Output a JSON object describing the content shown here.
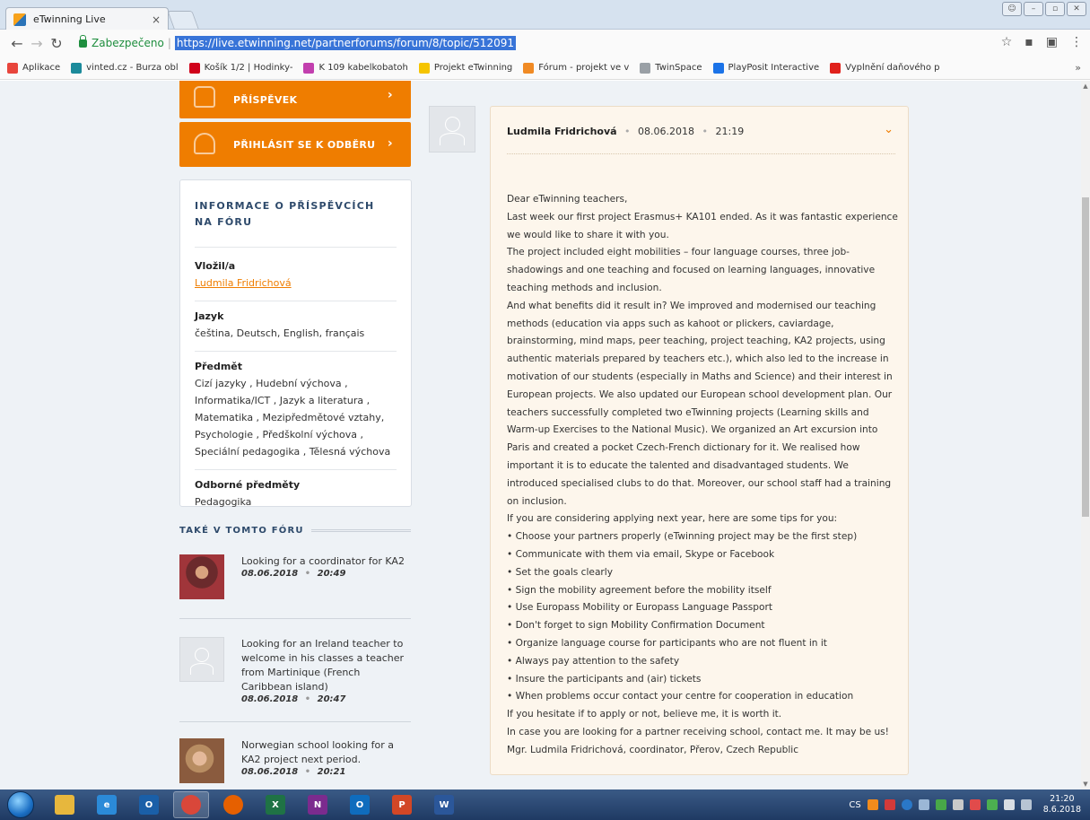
{
  "browser": {
    "tab_title": "eTwinning Live",
    "tab_close": "×",
    "secure_label": "Zabezpečeno",
    "url": "https://live.etwinning.net/partnerforums/forum/8/topic/512091",
    "bookmarks": [
      {
        "label": "Aplikace",
        "color": "#e8453c"
      },
      {
        "label": "vinted.cz - Burza obl",
        "color": "#1b8a9b"
      },
      {
        "label": "Košík 1/2 | Hodinky-",
        "color": "#d0021b"
      },
      {
        "label": "K 109 kabelkobatoh",
        "color": "#c23fae"
      },
      {
        "label": "Projekt eTwinning",
        "color": "#f5c400"
      },
      {
        "label": "Fórum - projekt ve v",
        "color": "#f08a24"
      },
      {
        "label": "TwinSpace",
        "color": "#9aa0a6"
      },
      {
        "label": "PlayPosit Interactive",
        "color": "#1b73e8"
      },
      {
        "label": "Vyplnění daňového p",
        "color": "#e0211b"
      }
    ],
    "bookmarks_more": "»"
  },
  "sidebar": {
    "buttons": [
      {
        "label": "PŘÍSPĚVEK"
      },
      {
        "label": "PŘIHLÁSIT SE K ODBĚRU"
      }
    ],
    "info": {
      "title": "INFORMACE O PŘÍSPĚVCÍCH NA FÓRU",
      "author_label": "Vložil/a",
      "author": "Ludmila Fridrichová",
      "language_label": "Jazyk",
      "language": "čeština, Deutsch, English, français",
      "subject_label": "Předmět",
      "subject": "Cizí jazyky , Hudební výchova , Informatika/ICT , Jazyk a literatura , Matematika , Mezipředmětové vztahy, Psychologie , Předškolní výchova , Speciální pedagogika , Tělesná výchova",
      "specialized_label": "Odborné předměty",
      "specialized": "Pedagogika"
    },
    "also_title": "TAKÉ V TOMTO FÓRU",
    "also_items": [
      {
        "title": "Looking for a coordinator for KA2",
        "date": "08.06.2018",
        "time": "20:49"
      },
      {
        "title": "Looking for an Ireland teacher to welcome in his classes a teacher from Martinique (French Caribbean island)",
        "date": "08.06.2018",
        "time": "20:47"
      },
      {
        "title": "Norwegian school looking for a KA2 project next period.",
        "date": "08.06.2018",
        "time": "20:21"
      }
    ]
  },
  "post": {
    "author": "Ludmila Fridrichová",
    "date": "08.06.2018",
    "time": "21:19",
    "sep": "•",
    "body": "Dear eTwinning teachers,\nLast week our first project Erasmus+ KA101 ended. As it was fantastic experience we would like to share it with you.\nThe project included eight mobilities – four language courses, three job-shadowings and one teaching and focused on learning languages, innovative teaching methods and inclusion.\nAnd what benefits did it result in? We improved and modernised our teaching methods (education via apps such as kahoot or plickers, caviardage, brainstorming, mind maps, peer teaching, project teaching, KA2 projects, using authentic materials prepared by teachers etc.), which also led to the increase in motivation of our students (especially in Maths and Science) and their interest in European projects. We also updated our European school development plan. Our teachers successfully completed two eTwinning projects (Learning skills and Warm-up Exercises to the National Music). We organized an Art excursion into Paris and created a pocket Czech-French dictionary for it. We realised how important it is to educate the talented and disadvantaged students. We introduced specialised clubs to do that. Moreover, our school staff had a training on inclusion.\nIf you are considering applying next year, here are some tips for you:\n• Choose your partners properly (eTwinning project may be the first step)\n• Communicate with them via email, Skype or Facebook\n• Set the goals clearly\n• Sign the mobility agreement before the mobility itself\n• Use Europass Mobility or Europass Language Passport\n• Don't forget to sign Mobility Confirmation Document\n• Organize language course for participants who are not fluent in it\n• Always pay attention to the safety\n• Insure the participants and (air) tickets\n• When problems occur contact your centre for cooperation in education\nIf you hesitate if to apply or not, believe me, it is worth it.\nIn case you are looking for a partner receiving school, contact me. It may be us!\nMgr. Ludmila Fridrichová, coordinator, Přerov, Czech Republic"
  },
  "taskbar": {
    "apps": [
      {
        "name": "explorer",
        "glyph": "",
        "color": "#e7b73d"
      },
      {
        "name": "internet-explorer",
        "glyph": "e",
        "color": "#2b8ad8"
      },
      {
        "name": "outlook-app",
        "glyph": "O",
        "color": "#1a5fa8"
      },
      {
        "name": "chrome",
        "glyph": "",
        "color": "#d9473a"
      },
      {
        "name": "firefox",
        "glyph": "",
        "color": "#e66000"
      },
      {
        "name": "excel",
        "glyph": "X",
        "color": "#1f7245"
      },
      {
        "name": "onenote",
        "glyph": "N",
        "color": "#7b2b8e"
      },
      {
        "name": "outlook",
        "glyph": "O",
        "color": "#0f6cbd"
      },
      {
        "name": "powerpoint",
        "glyph": "P",
        "color": "#d24726"
      },
      {
        "name": "word",
        "glyph": "W",
        "color": "#2b579a"
      }
    ],
    "lang": "CS",
    "time": "21:20",
    "date": "8.6.2018"
  }
}
